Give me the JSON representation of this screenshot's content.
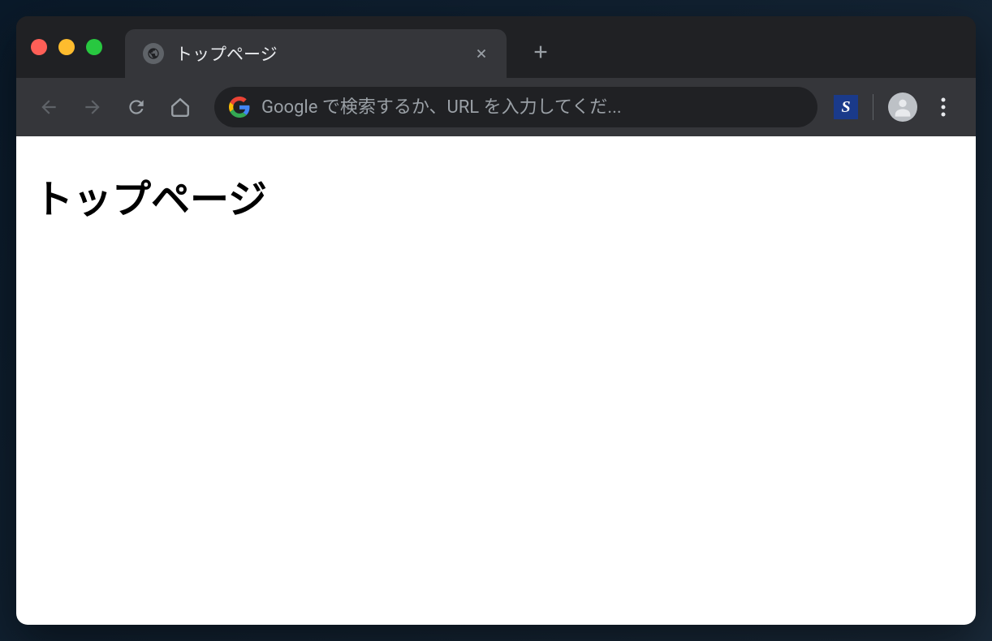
{
  "tab": {
    "title": "トップページ",
    "favicon": "globe-icon"
  },
  "omnibox": {
    "placeholder": "Google で検索するか、URL を入力してくだ...",
    "value": ""
  },
  "extension": {
    "label": "S"
  },
  "page": {
    "heading": "トップページ"
  }
}
